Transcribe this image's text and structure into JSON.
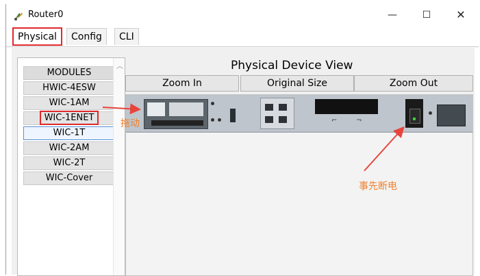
{
  "window": {
    "title": "Router0",
    "minimize_glyph": "—",
    "maximize_glyph": "☐",
    "close_glyph": "✕"
  },
  "tabs": [
    {
      "label": "Physical",
      "active": true
    },
    {
      "label": "Config",
      "active": false
    },
    {
      "label": "CLI",
      "active": false
    }
  ],
  "modules": {
    "header": "MODULES",
    "items": [
      "HWIC-4ESW",
      "WIC-1AM",
      "WIC-1ENET",
      "WIC-1T",
      "WIC-2AM",
      "WIC-2T",
      "WIC-Cover"
    ],
    "highlighted": "WIC-1ENET",
    "selected": "WIC-1T"
  },
  "device_view": {
    "title": "Physical Device View",
    "zoom_in": "Zoom In",
    "original_size": "Original Size",
    "zoom_out": "Zoom Out"
  },
  "annotations": {
    "drag": "拖动",
    "power_off_first": "事先断电"
  },
  "colors": {
    "highlight_red": "#e0272b",
    "annotation_orange": "#f0812f",
    "arrow_red": "#e8443a"
  },
  "icons": {
    "app": "router-app-icon",
    "scroll": "scroll-up-icon"
  }
}
